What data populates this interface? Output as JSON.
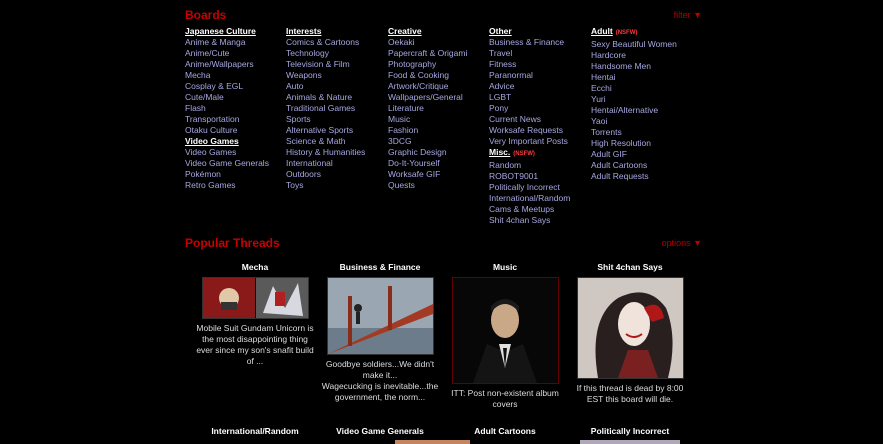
{
  "boards": {
    "title": "Boards",
    "filter_label": "filter ▼",
    "columns": [
      {
        "groups": [
          {
            "header": "Japanese Culture",
            "nsfw": false,
            "items": [
              "Anime & Manga",
              "Anime/Cute",
              "Anime/Wallpapers",
              "Mecha",
              "Cosplay & EGL",
              "Cute/Male",
              "Flash",
              "Transportation",
              "Otaku Culture"
            ]
          },
          {
            "header": "Video Games",
            "nsfw": false,
            "items": [
              "Video Games",
              "Video Game Generals",
              "Pokémon",
              "Retro Games"
            ]
          }
        ]
      },
      {
        "groups": [
          {
            "header": "Interests",
            "nsfw": false,
            "items": [
              "Comics & Cartoons",
              "Technology",
              "Television & Film",
              "Weapons",
              "Auto",
              "Animals & Nature",
              "Traditional Games",
              "Sports",
              "Alternative Sports",
              "Science & Math",
              "History & Humanities",
              "International",
              "Outdoors",
              "Toys"
            ]
          }
        ]
      },
      {
        "groups": [
          {
            "header": "Creative",
            "nsfw": false,
            "items": [
              "Oekaki",
              "Papercraft & Origami",
              "Photography",
              "Food & Cooking",
              "Artwork/Critique",
              "Wallpapers/General",
              "Literature",
              "Music",
              "Fashion",
              "3DCG",
              "Graphic Design",
              "Do-It-Yourself",
              "Worksafe GIF",
              "Quests"
            ]
          }
        ]
      },
      {
        "groups": [
          {
            "header": "Other",
            "nsfw": false,
            "items": [
              "Business & Finance",
              "Travel",
              "Fitness",
              "Paranormal",
              "Advice",
              "LGBT",
              "Pony",
              "Current News",
              "Worksafe Requests",
              "Very Important Posts"
            ]
          },
          {
            "header": "Misc.",
            "nsfw": true,
            "items": [
              "Random",
              "ROBOT9001",
              "Politically Incorrect",
              "International/Random",
              "Cams & Meetups",
              "Shit 4chan Says"
            ]
          }
        ]
      },
      {
        "groups": [
          {
            "header": "Adult",
            "nsfw": true,
            "items": [
              "Sexy Beautiful Women",
              "Hardcore",
              "Handsome Men",
              "Hentai",
              "Ecchi",
              "Yuri",
              "Hentai/Alternative",
              "Yaoi",
              "Torrents",
              "High Resolution",
              "Adult GIF",
              "Adult Cartoons",
              "Adult Requests"
            ]
          }
        ]
      }
    ],
    "nsfw_label": "(NSFW)"
  },
  "popular": {
    "title": "Popular Threads",
    "options_label": "options ▼",
    "threads": [
      {
        "board": "Mecha",
        "caption": [
          "Mobile Suit Gundam Unicorn is",
          "the most disappointing thing",
          "ever since my son's snafit build",
          "of ..."
        ]
      },
      {
        "board": "Business & Finance",
        "caption": [
          "Goodbye soldiers...We didn't",
          "make it...",
          "Wagecucking is inevitable...the",
          "government, the norm..."
        ]
      },
      {
        "board": "Music",
        "caption": [
          "ITT: Post non-existent album",
          "covers"
        ]
      },
      {
        "board": "Shit 4chan Says",
        "caption": [
          "If this thread is dead by 8:00",
          "EST this board will die."
        ]
      }
    ],
    "row2": [
      "International/Random",
      "Video Game Generals",
      "Adult Cartoons",
      "Politically Incorrect"
    ]
  }
}
